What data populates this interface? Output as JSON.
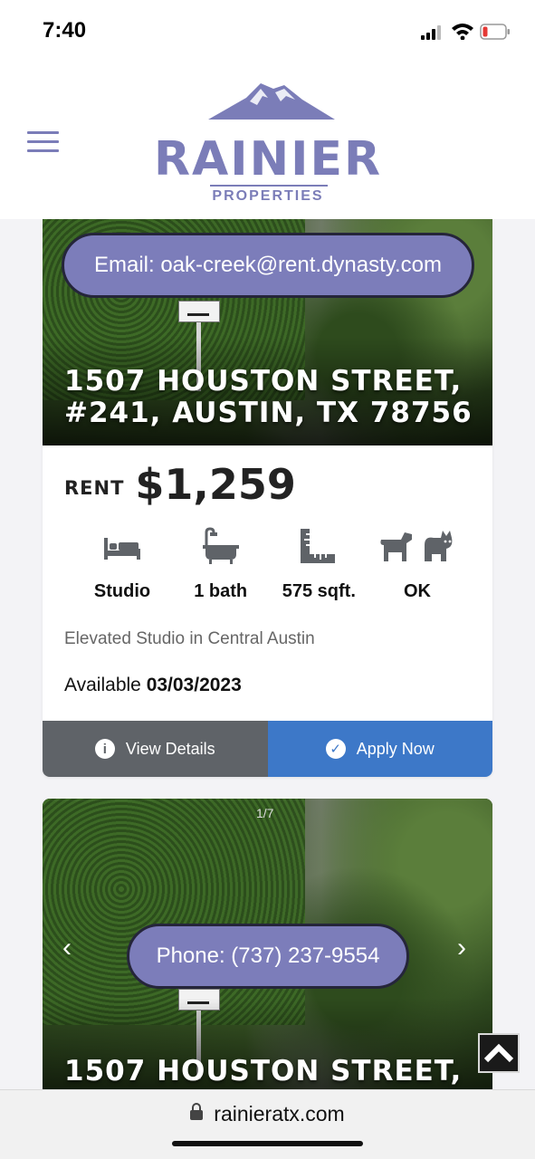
{
  "status_bar": {
    "time": "7:40"
  },
  "header": {
    "logo_word": "RAINIER",
    "logo_sub": "PROPERTIES"
  },
  "listing_1": {
    "email_pill": "Email: oak-creek@rent.dynasty.com",
    "address_line1": "1507 HOUSTON STREET,",
    "address_line2": "#241, AUSTIN, TX 78756",
    "rent_label": "RENT",
    "rent_value": "$1,259",
    "features": {
      "bed": "Studio",
      "bath": "1 bath",
      "sqft": "575 sqft.",
      "pets": "OK"
    },
    "description": "Elevated Studio in Central Austin",
    "available_label": "Available",
    "available_date": "03/03/2023",
    "view_details": "View Details",
    "apply_now": "Apply Now",
    "colors": {
      "view_bg": "#5f6368",
      "apply_bg": "#3d78c8"
    }
  },
  "listing_2": {
    "counter": "1/7",
    "phone_pill": "Phone: (737) 237-9554",
    "address_line1": "1507 HOUSTON STREET,"
  },
  "browser": {
    "url": "rainieratx.com"
  },
  "colors": {
    "brand": "#7b7db8",
    "pill": "#7c7dba"
  }
}
